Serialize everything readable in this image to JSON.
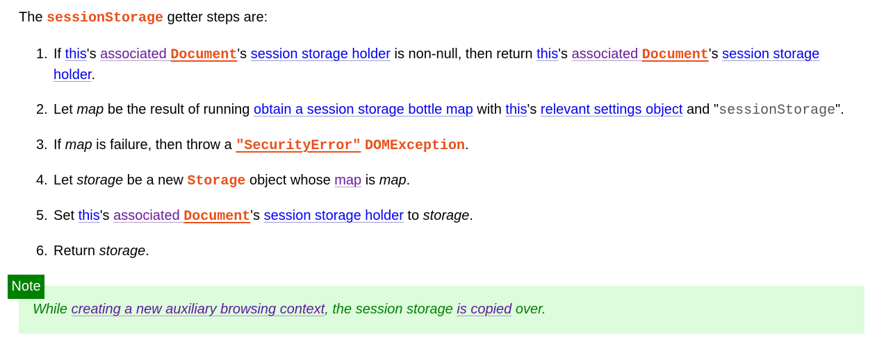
{
  "intro": {
    "before": "The ",
    "code": "sessionStorage",
    "after": " getter steps are:"
  },
  "steps": [
    {
      "num": "1.",
      "parts": {
        "t1": "If ",
        "this1": "this",
        "t2": "'s ",
        "assoc1": "associated ",
        "doc1": "Document",
        "t3": "'s ",
        "holder1": "session storage holder",
        "t4": " is non-null, then return ",
        "this2": "this",
        "t5": "'s ",
        "assoc2": "associated ",
        "doc2": "Document",
        "t6": "'s ",
        "holder2": "session storage holder",
        "t7": "."
      }
    },
    {
      "num": "2.",
      "parts": {
        "t1": "Let ",
        "map": "map",
        "t2": " be the result of running ",
        "obtain": "obtain a session storage bottle map",
        "t3": " with ",
        "this": "this",
        "t4": "'s ",
        "relevant": "relevant settings object",
        "t5": " and \"",
        "code": "sessionStorage",
        "t6": "\"."
      }
    },
    {
      "num": "3.",
      "parts": {
        "t1": "If ",
        "map": "map",
        "t2": " is failure, then throw a ",
        "sec": "\"SecurityError\"",
        "t3": " ",
        "domex": "DOMException",
        "t4": "."
      }
    },
    {
      "num": "4.",
      "parts": {
        "t1": "Let ",
        "storage": "storage",
        "t2": " be a new ",
        "storageCode": "Storage",
        "t3": " object whose ",
        "mapLink": "map",
        "t4": " is ",
        "map": "map",
        "t5": "."
      }
    },
    {
      "num": "5.",
      "parts": {
        "t1": "Set ",
        "this": "this",
        "t2": "'s ",
        "assoc": "associated ",
        "doc": "Document",
        "t3": "'s ",
        "holder": "session storage holder",
        "t4": " to ",
        "storage": "storage",
        "t5": "."
      }
    },
    {
      "num": "6.",
      "parts": {
        "t1": "Return ",
        "storage": "storage",
        "t2": "."
      }
    }
  ],
  "note": {
    "label": "Note",
    "t1": "While ",
    "link1": "creating a new auxiliary browsing context",
    "t2": ", the session storage ",
    "link2": "is copied",
    "t3": " over."
  },
  "colors": {
    "link_blue": "#0000ee",
    "link_purple": "#6a1b9a",
    "code_orange": "#e8501a",
    "note_green": "#008000",
    "note_bg": "#dcfcdc"
  }
}
